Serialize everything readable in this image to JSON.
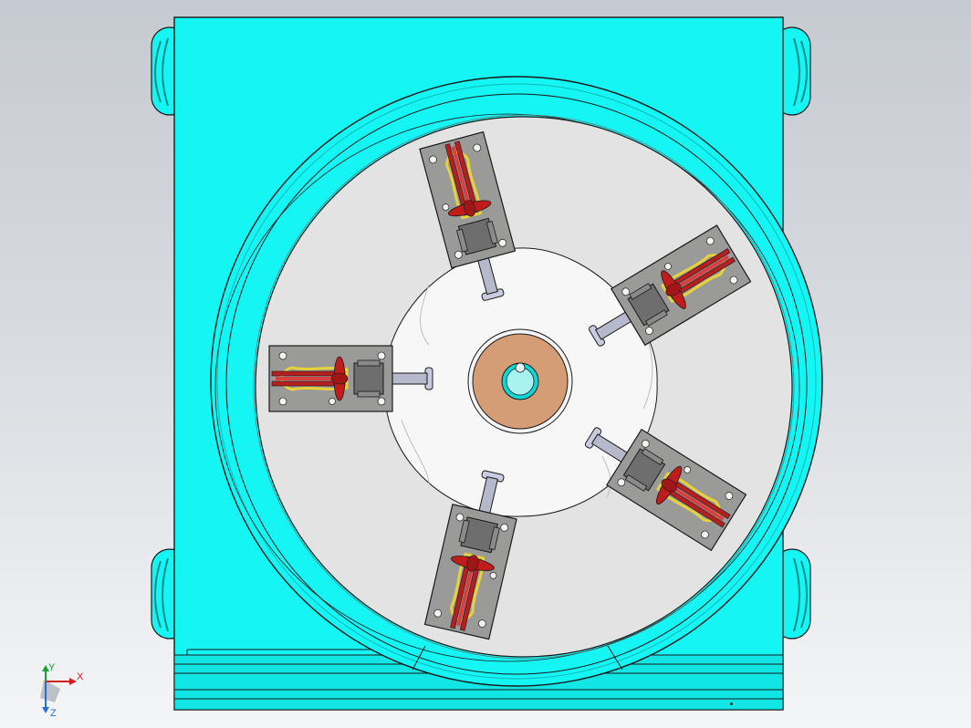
{
  "triad": {
    "x_label": "X",
    "y_label": "Y",
    "z_label": "Z"
  },
  "colors": {
    "housing": "#14f5f4",
    "housing_dark": "#0fb9b9",
    "disc": "#e3e3e3",
    "hub": "#f7f7f7",
    "bushing": "#d59d76",
    "shaft": "#a8f2f2",
    "clamp_plate": "#9a9a99",
    "clamp_handle": "#c01c1c",
    "clamp_spring": "#e8d23a",
    "plunger": "#b6b8cc",
    "outline": "#1a1a1a"
  },
  "model": {
    "clamp_count": 5
  }
}
